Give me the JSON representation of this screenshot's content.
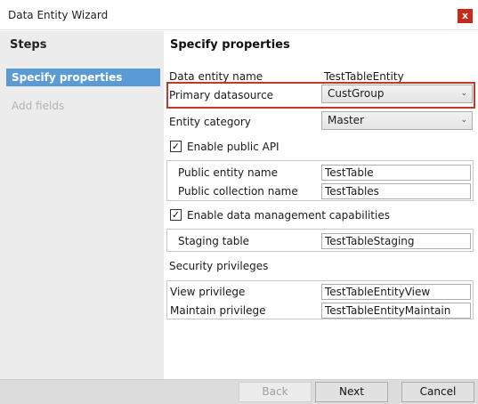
{
  "window": {
    "title": "Data Entity Wizard",
    "close_glyph": "x"
  },
  "sidebar": {
    "heading": "Steps",
    "items": [
      {
        "label": "Specify properties",
        "state": "active"
      },
      {
        "label": "Add fields",
        "state": "disabled"
      }
    ]
  },
  "main": {
    "heading": "Specify properties",
    "entity_name_label": "Data entity name",
    "entity_name_value": "TestTableEntity",
    "primary_datasource_label": "Primary datasource",
    "primary_datasource_value": "CustGroup",
    "entity_category_label": "Entity category",
    "entity_category_value": "Master",
    "public_api": {
      "label": "Enable public API",
      "checked": true,
      "public_entity_name_label": "Public entity name",
      "public_entity_name_value": "TestTable",
      "public_collection_name_label": "Public collection name",
      "public_collection_name_value": "TestTables"
    },
    "data_management": {
      "label": "Enable data management capabilities",
      "checked": true,
      "staging_table_label": "Staging table",
      "staging_table_value": "TestTableStaging"
    },
    "security": {
      "heading": "Security privileges",
      "view_label": "View privilege",
      "view_value": "TestTableEntityView",
      "maintain_label": "Maintain privilege",
      "maintain_value": "TestTableEntityMaintain"
    }
  },
  "footer": {
    "back_label": "Back",
    "next_label": "Next",
    "cancel_label": "Cancel"
  },
  "colors": {
    "accent": "#5b9bd5",
    "highlight_border": "#c0392b",
    "close_button": "#c42b1c"
  },
  "icons": {
    "check": "checkmark-icon",
    "dropdown": "chevron-down-icon",
    "close": "close-icon"
  }
}
